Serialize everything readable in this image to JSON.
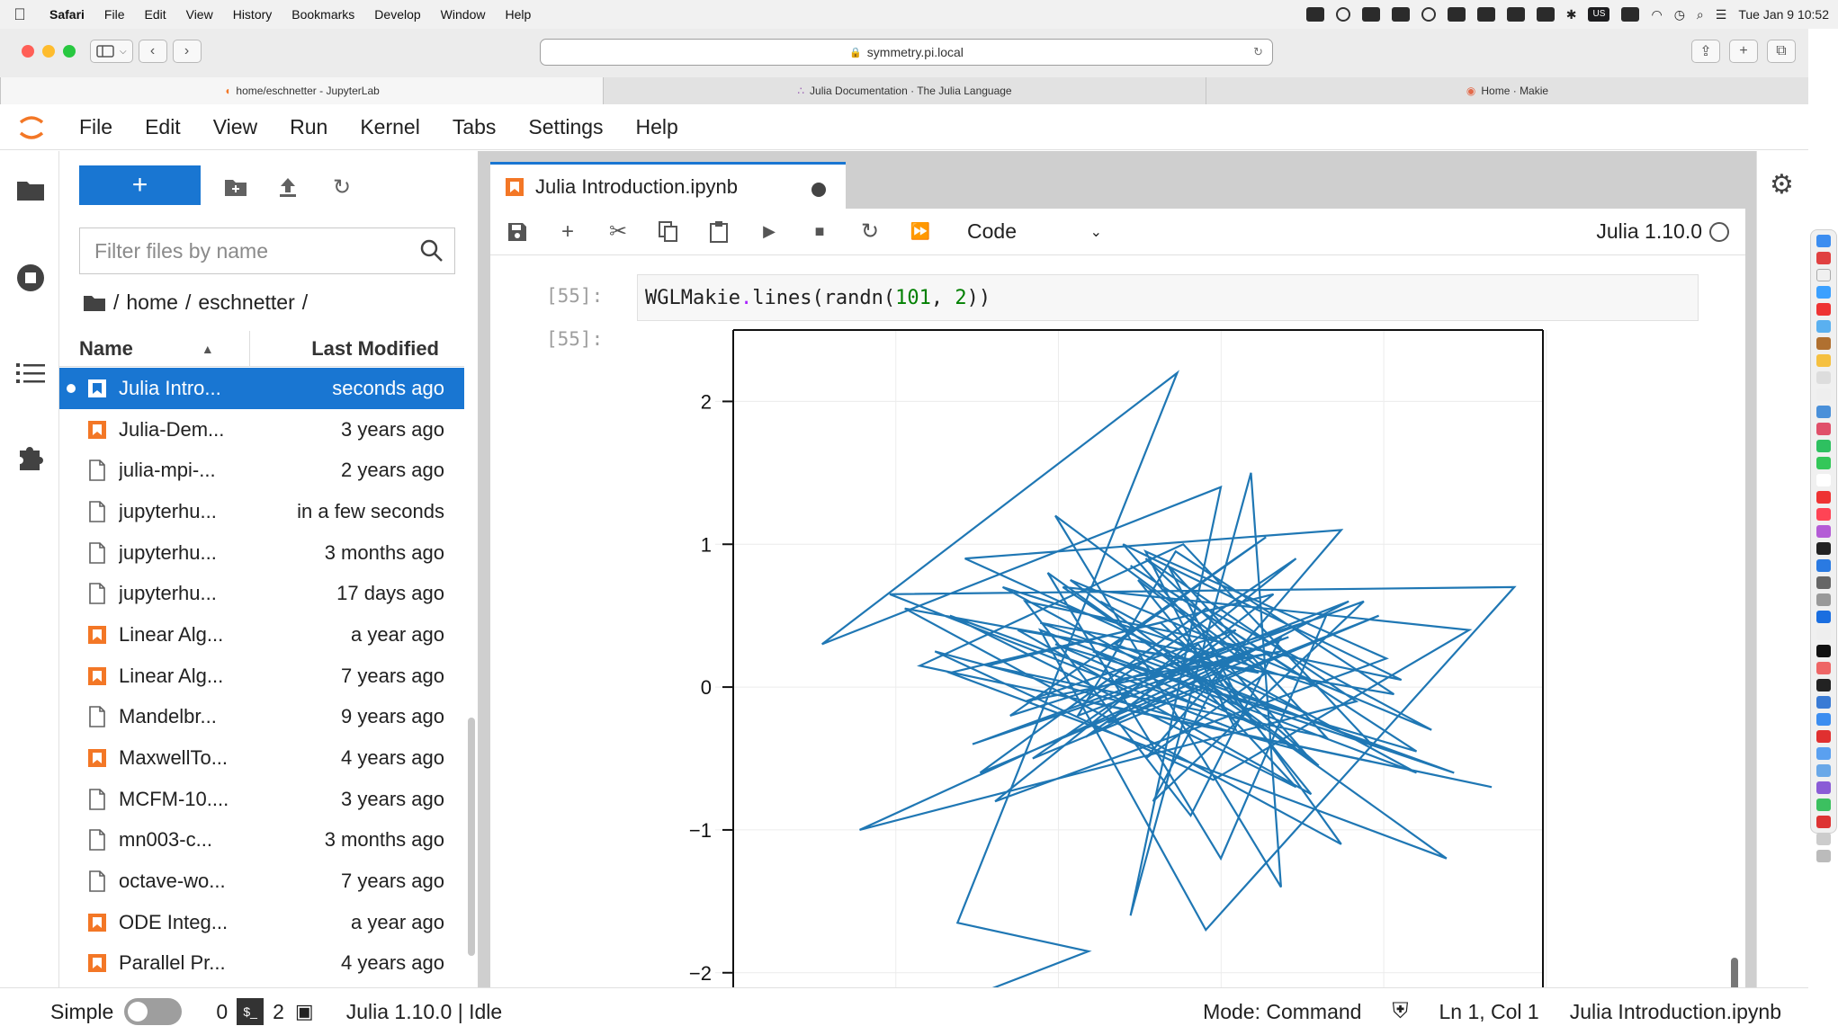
{
  "mac_menubar": {
    "app": "Safari",
    "items": [
      "File",
      "Edit",
      "View",
      "History",
      "Bookmarks",
      "Develop",
      "Window",
      "Help"
    ],
    "input_source": "US",
    "clock": "Tue Jan 9  10:52"
  },
  "safari": {
    "url": "symmetry.pi.local",
    "tabs": [
      {
        "label": "home/eschnetter - JupyterLab",
        "icon": "jupyter-icon",
        "active": true
      },
      {
        "label": "Julia Documentation · The Julia Language",
        "icon": "julia-icon",
        "active": false
      },
      {
        "label": "Home · Makie",
        "icon": "makie-icon",
        "active": false
      }
    ],
    "traffic_colors": [
      "#ff5f57",
      "#febc2e",
      "#28c840"
    ]
  },
  "jupyter_menu": [
    "File",
    "Edit",
    "View",
    "Run",
    "Kernel",
    "Tabs",
    "Settings",
    "Help"
  ],
  "file_browser": {
    "new_label": "+",
    "filter_placeholder": "Filter files by name",
    "breadcrumb": {
      "root": "/",
      "home": "home",
      "sep": "/",
      "user": "eschnetter",
      "end": "/"
    },
    "col_name": "Name",
    "col_modified": "Last Modified",
    "files": [
      {
        "name": "Julia Intro...",
        "modified": "seconds ago",
        "type": "notebook",
        "selected": true,
        "running": true
      },
      {
        "name": "Julia-Dem...",
        "modified": "3 years ago",
        "type": "notebook"
      },
      {
        "name": "julia-mpi-...",
        "modified": "2 years ago",
        "type": "file"
      },
      {
        "name": "jupyterhu...",
        "modified": "in a few seconds",
        "type": "file"
      },
      {
        "name": "jupyterhu...",
        "modified": "3 months ago",
        "type": "file"
      },
      {
        "name": "jupyterhu...",
        "modified": "17 days ago",
        "type": "file"
      },
      {
        "name": "Linear Alg...",
        "modified": "a year ago",
        "type": "notebook"
      },
      {
        "name": "Linear Alg...",
        "modified": "7 years ago",
        "type": "notebook"
      },
      {
        "name": "Mandelbr...",
        "modified": "9 years ago",
        "type": "file"
      },
      {
        "name": "MaxwellTo...",
        "modified": "4 years ago",
        "type": "notebook"
      },
      {
        "name": "MCFM-10....",
        "modified": "3 years ago",
        "type": "file"
      },
      {
        "name": "mn003-c...",
        "modified": "3 months ago",
        "type": "file"
      },
      {
        "name": "octave-wo...",
        "modified": "7 years ago",
        "type": "file"
      },
      {
        "name": "ODE Integ...",
        "modified": "a year ago",
        "type": "notebook"
      },
      {
        "name": "Parallel Pr...",
        "modified": "4 years ago",
        "type": "notebook"
      }
    ]
  },
  "notebook": {
    "tab_title": "Julia Introduction.ipynb",
    "cell_type": "Code",
    "kernel": "Julia 1.10.0",
    "input_prompt": "[55]:",
    "output_prompt": "[55]:",
    "code": {
      "fn": "WGLMakie",
      "dot": ".",
      "call": "lines(randn(",
      "n": "101",
      "comma": ", ",
      "k": "2",
      "close": "))"
    }
  },
  "chart_data": {
    "type": "line",
    "title": "",
    "xlabel": "",
    "ylabel": "",
    "ytick_labels": [
      "2",
      "1",
      "0",
      "−1",
      "−2"
    ],
    "yticks": [
      2,
      1,
      0,
      -1,
      -2
    ],
    "ylim": [
      -2.65,
      2.5
    ],
    "xlim": [
      -3.0,
      2.5
    ],
    "grid": true,
    "color": "#1f77b4",
    "series": [
      {
        "x": [
          -2.55,
          -0.58,
          -1.45,
          0.01,
          -2.35,
          0.3,
          -0.3,
          0.5,
          0.7,
          -0.8,
          0.6,
          -0.2,
          1.1,
          -1.4,
          0.9,
          -0.5,
          1.6,
          -0.9,
          0.2,
          2.25,
          -1.9,
          0.4,
          -0.2,
          1.4,
          -1.2,
          0.8,
          -0.6,
          2.1,
          -1.7,
          0.05,
          1.3,
          -0.4,
          0.6,
          -1.1,
          1.0,
          0.3,
          -0.85,
          1.8,
          -1.5,
          -0.1,
          0.95,
          -0.7,
          1.7,
          0.2,
          -1.3,
          0.5,
          -0.2,
          1.2,
          -2.1,
          0.7,
          0.1,
          -1.0,
          1.5,
          -0.35,
          0.85,
          -1.6,
          0.25,
          1.95,
          -0.75,
          0.45,
          -0.05,
          1.0,
          -1.25,
          0.65,
          -0.45,
          1.35,
          -0.95,
          0.15,
          1.1,
          -1.8,
          0.55,
          -0.25,
          0.9,
          -1.05,
          1.45,
          0.0,
          -0.65,
          0.75,
          -1.35,
          1.25,
          -0.15,
          0.35,
          -0.9,
          1.85,
          -0.55,
          0.6,
          -1.15,
          0.95,
          -0.3,
          1.6,
          -0.8,
          0.2,
          -1.5,
          0.8,
          0.05,
          1.15,
          -0.6,
          0.4,
          -1.0,
          0.7,
          -0.4
        ],
        "y": [
          -2.65,
          -1.85,
          -1.65,
          2.2,
          0.3,
          1.4,
          -1.6,
          1.5,
          -1.4,
          1.2,
          0.1,
          -0.5,
          1.1,
          0.9,
          -0.2,
          0.6,
          -0.6,
          0.4,
          -1.7,
          0.7,
          0.65,
          -0.3,
          0.95,
          0.2,
          -0.8,
          0.9,
          -0.1,
          -0.7,
          0.15,
          1.0,
          -0.4,
          0.3,
          1.05,
          -0.2,
          0.5,
          -1.2,
          0.8,
          -1.2,
          0.1,
          0.45,
          -0.55,
          0.75,
          -0.3,
          0.55,
          -0.6,
          0.2,
          0.9,
          -0.1,
          -1.0,
          0.35,
          -0.9,
          0.6,
          0.05,
          1.0,
          -0.45,
          0.25,
          -0.65,
          0.4,
          0.7,
          -0.15,
          0.85,
          -0.35,
          0.15,
          0.65,
          -0.25,
          0.5,
          -0.5,
          0.3,
          -1.1,
          0.55,
          0.1,
          0.75,
          -0.75,
          0.4,
          -0.05,
          0.95,
          -0.2,
          0.35,
          -0.4,
          0.6,
          -0.8,
          0.2,
          0.45,
          -0.6,
          0.25,
          -0.3,
          0.7,
          0.0,
          0.85,
          -0.45,
          0.3,
          -0.15,
          0.5,
          -0.7,
          0.15,
          0.6,
          -0.35,
          0.4,
          -0.1,
          0.25,
          0.05
        ]
      }
    ]
  },
  "statusbar": {
    "mode_label": "Simple",
    "count_a": "0",
    "terminal_glyph": "$_",
    "count_b": "2",
    "kernel_status": "Julia 1.10.0 | Idle",
    "mode": "Mode: Command",
    "cursor": "Ln 1, Col 1",
    "file": "Julia Introduction.ipynb"
  },
  "colors": {
    "accent": "#1976d2",
    "notebook_icon": "#f37726",
    "jupyter_orange": "#f37726"
  }
}
